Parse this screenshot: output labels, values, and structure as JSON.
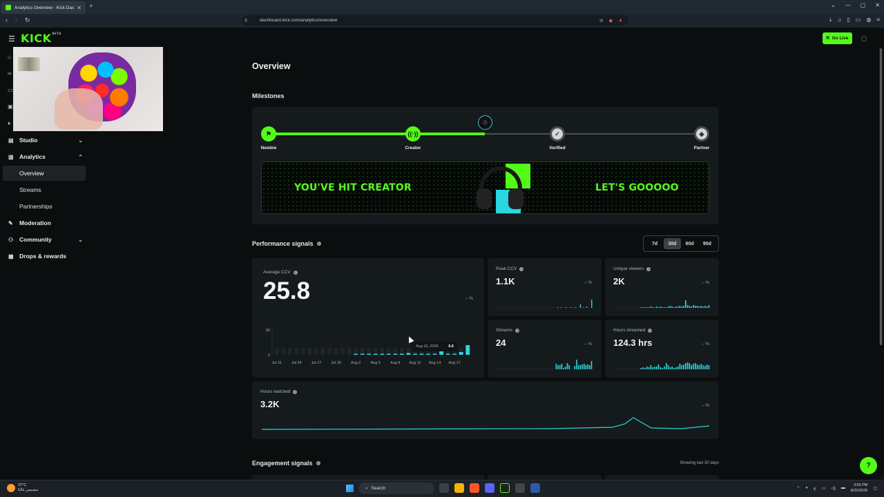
{
  "browser": {
    "tab_title": "Analytics Overview - Kick Dashb...",
    "tab_close": "✕",
    "new_tab": "+",
    "url": "dashboard.kick.com/analytics/overview",
    "win_controls": [
      "⌄",
      "—",
      "▢",
      "✕"
    ]
  },
  "header": {
    "logo": "KICK",
    "logo_badge": "BETA",
    "go_live_label": "Go Live"
  },
  "sidebar": {
    "items": [
      {
        "label": "Studio",
        "icon": "studio-icon",
        "expanded": false
      },
      {
        "label": "Analytics",
        "icon": "analytics-icon",
        "expanded": true
      },
      {
        "label": "Moderation",
        "icon": "wrench-icon"
      },
      {
        "label": "Community",
        "icon": "community-icon",
        "expanded": false
      },
      {
        "label": "Drops & rewards",
        "icon": "drops-icon"
      }
    ],
    "analytics_sub": [
      "Overview",
      "Streams",
      "Partnerships"
    ],
    "active_sub": "Overview"
  },
  "page": {
    "title": "Overview",
    "milestones_heading": "Milestones",
    "milestones": [
      {
        "label": "Newbie",
        "done": true,
        "icon": "flag-icon"
      },
      {
        "label": "Creator",
        "done": true,
        "icon": "broadcast-icon"
      },
      {
        "label": "Verified",
        "done": false,
        "icon": "check-badge-icon"
      },
      {
        "label": "Partner",
        "done": false,
        "icon": "partner-badge-icon"
      }
    ],
    "progress": 0.5,
    "banner_left": "YOU'VE HIT CREATOR",
    "banner_right": "LET'S GOOOOO"
  },
  "performance": {
    "heading": "Performance signals",
    "ranges": [
      "7d",
      "30d",
      "60d",
      "90d"
    ],
    "selected_range": "30d",
    "average_ccv": {
      "label": "Average CCV",
      "value": "25.8",
      "delta": "-- %",
      "y_ticks": [
        "90",
        "0"
      ],
      "x_ticks": [
        "Jul 21",
        "Jul 24",
        "Jul 27",
        "Jul 30",
        "Aug 2",
        "Aug 5",
        "Aug 8",
        "Aug 11",
        "Aug 14",
        "Aug 17"
      ],
      "tooltip_date": "Aug 10, 2026",
      "tooltip_value": "6.6"
    },
    "peak_ccv": {
      "label": "Peak CCV",
      "value": "1.1K",
      "delta": "-- %"
    },
    "unique_viewers": {
      "label": "Unique viewers",
      "value": "2K",
      "delta": "-- %"
    },
    "streams": {
      "label": "Streams",
      "value": "24",
      "delta": "-- %"
    },
    "hours_streamed": {
      "label": "Hours streamed",
      "value": "124.3 hrs",
      "delta": "-- %"
    },
    "hours_watched": {
      "label": "Hours watched",
      "value": "3.2K",
      "delta": "-- %"
    }
  },
  "engagement": {
    "heading": "Engagement signals",
    "showing": "Showing last 30 days"
  },
  "taskbar": {
    "weather_temp": "37°C",
    "weather_desc": "مشمس غالبًا",
    "search_label": "Search",
    "time": "3:55 PM",
    "date": "8/20/2026",
    "lang": "ع"
  },
  "colors": {
    "accent": "#53fc18",
    "cyan": "#2ad6e0",
    "panel": "#151a1c",
    "bg": "#0b0e0f"
  },
  "chart_data": [
    {
      "type": "bar",
      "title": "Average CCV",
      "categories": [
        "Jul 21",
        "Jul 22",
        "Jul 23",
        "Jul 24",
        "Jul 25",
        "Jul 26",
        "Jul 27",
        "Jul 28",
        "Jul 29",
        "Jul 30",
        "Jul 31",
        "Aug 1",
        "Aug 2",
        "Aug 3",
        "Aug 4",
        "Aug 5",
        "Aug 6",
        "Aug 7",
        "Aug 8",
        "Aug 9",
        "Aug 10",
        "Aug 11",
        "Aug 12",
        "Aug 13",
        "Aug 14",
        "Aug 15",
        "Aug 16",
        "Aug 17",
        "Aug 18",
        "Aug 19"
      ],
      "values": [
        0,
        0,
        0,
        0,
        0,
        0,
        0,
        0,
        0,
        0,
        0,
        0,
        2,
        2,
        2,
        2,
        3,
        2,
        3,
        4,
        6.6,
        2,
        3,
        2,
        3,
        35,
        3,
        2,
        10,
        35
      ],
      "ylim": [
        0,
        90
      ],
      "xlabel": "",
      "ylabel": ""
    }
  ]
}
